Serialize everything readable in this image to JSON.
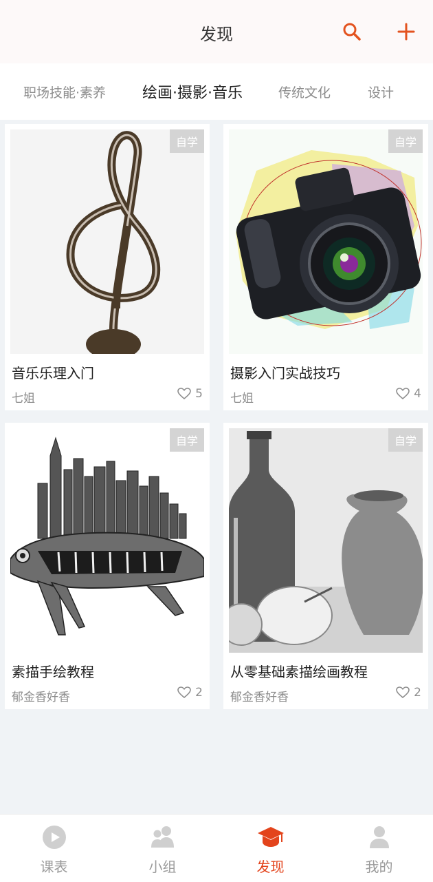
{
  "header": {
    "title": "发现",
    "icons": [
      "search-icon",
      "plus-icon"
    ],
    "accent_color": "#e3531f"
  },
  "tabs": [
    {
      "label": "职场技能·素养",
      "active": false
    },
    {
      "label": "绘画·摄影·音乐",
      "active": true
    },
    {
      "label": "传统文化",
      "active": false
    },
    {
      "label": "设计",
      "active": false
    }
  ],
  "courses": [
    {
      "title": "音乐乐理入门",
      "author": "七姐",
      "likes": "5",
      "badge": "自学"
    },
    {
      "title": "摄影入门实战技巧",
      "author": "七姐",
      "likes": "4",
      "badge": "自学"
    },
    {
      "title": "素描手绘教程",
      "author": "郁金香好香",
      "likes": "2",
      "badge": "自学"
    },
    {
      "title": "从零基础素描绘画教程",
      "author": "郁金香好香",
      "likes": "2",
      "badge": "自学"
    }
  ],
  "bottom_nav": [
    {
      "label": "课表",
      "icon": "play-circle-icon",
      "active": false
    },
    {
      "label": "小组",
      "icon": "group-icon",
      "active": false
    },
    {
      "label": "发现",
      "icon": "graduation-cap-icon",
      "active": true
    },
    {
      "label": "我的",
      "icon": "user-icon",
      "active": false
    }
  ],
  "colors": {
    "active_nav": "#e3441c",
    "inactive_nav": "#9b9b9b",
    "background": "#f0f3f6"
  }
}
